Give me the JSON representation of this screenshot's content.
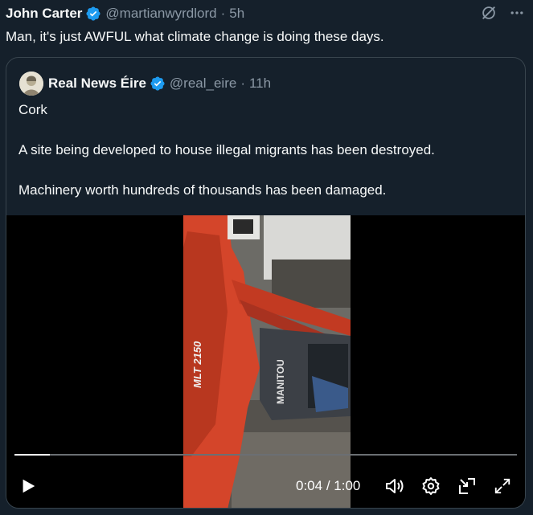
{
  "tweet": {
    "author_name": "John Carter",
    "author_handle": "@martianwyrdlord",
    "separator": "·",
    "time": "5h",
    "text": "Man, it's just AWFUL what climate change is doing these days."
  },
  "quoted_tweet": {
    "author_name": "Real News Éire",
    "author_handle": "@real_eire",
    "separator": "·",
    "time": "11h",
    "lines": [
      "Cork",
      "A site being developed to house illegal migrants has been destroyed.",
      "Machinery worth hundreds of thousands has been damaged."
    ]
  },
  "video": {
    "elapsed": "0:04",
    "time_separator": "/",
    "duration": "1:00",
    "progress_fraction": 0.07,
    "machine_text_1": "MLT 2150",
    "machine_text_2": "MANITOU"
  },
  "colors": {
    "background": "#15202b",
    "text": "#f7f9f9",
    "muted": "#8b98a5",
    "verified_blue": "#1d9bf0",
    "border": "#38444d"
  },
  "icons": [
    "verified-badge-icon",
    "grok-icon",
    "more-icon",
    "play-icon",
    "volume-icon",
    "settings-icon",
    "picture-in-picture-icon",
    "fullscreen-icon"
  ]
}
